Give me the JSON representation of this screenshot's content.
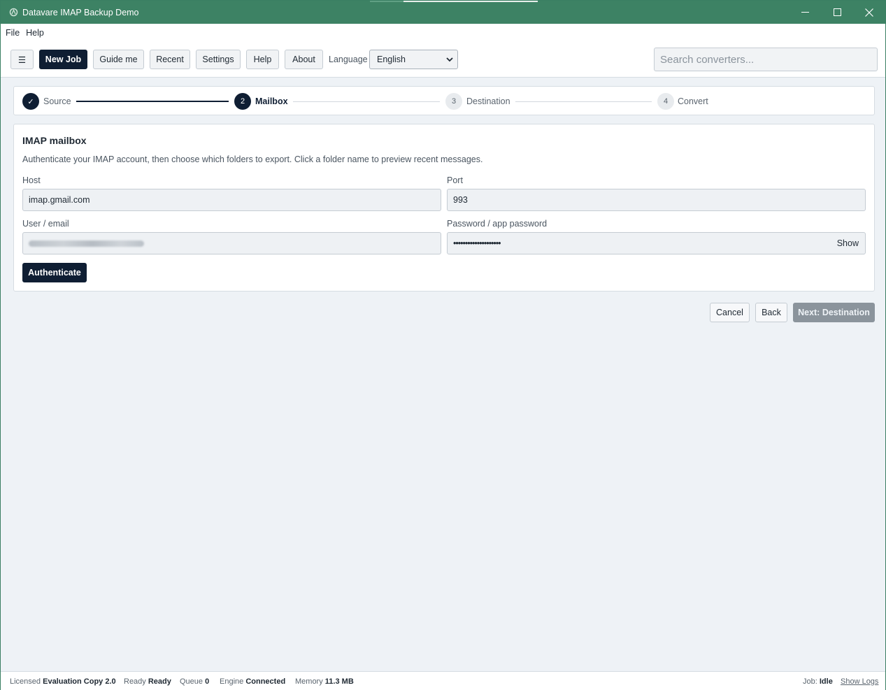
{
  "window": {
    "title": "Datavare IMAP Backup Demo",
    "controls": {
      "minimize": "—",
      "maximize": "☐",
      "close": "✕"
    }
  },
  "menu": [
    "File",
    "Help"
  ],
  "toolbar": {
    "hamburger": "☰",
    "new_job": "New Job",
    "guide_me": "Guide me",
    "recent": "Recent",
    "settings": "Settings",
    "help": "Help",
    "about": "About",
    "language_label": "Language",
    "language_value": "English",
    "search_placeholder": "Search converters..."
  },
  "stepper": {
    "steps": [
      {
        "number": "✓",
        "label": "Source",
        "state": "done"
      },
      {
        "number": "2",
        "label": "Mailbox",
        "state": "active"
      },
      {
        "number": "3",
        "label": "Destination",
        "state": "todo"
      },
      {
        "number": "4",
        "label": "Convert",
        "state": "todo"
      }
    ]
  },
  "card": {
    "title": "IMAP mailbox",
    "description": "Authenticate your IMAP account, then choose which folders to export. Click a folder name to preview recent messages.",
    "host_label": "Host",
    "host_value": "imap.gmail.com",
    "port_label": "Port",
    "port_value": "993",
    "user_label": "User / email",
    "password_label": "Password / app password",
    "password_value": "••••••••••••••••••••",
    "show_label": "Show",
    "authenticate": "Authenticate"
  },
  "nav": {
    "cancel": "Cancel",
    "back": "Back",
    "next": "Next: Destination"
  },
  "status": {
    "licensed_label": "Licensed",
    "licensed_value": "Evaluation Copy 2.0",
    "ready_label": "Ready",
    "ready_value": "Ready",
    "queue_label": "Queue",
    "queue_value": "0",
    "engine_label": "Engine",
    "engine_value": "Connected",
    "memory_label": "Memory",
    "memory_value": "11.3 MB",
    "job_label": "Job:",
    "job_value": "Idle",
    "show_logs": "Show Logs"
  },
  "colors": {
    "titlebar": "#3d8264",
    "primary": "#0f1e33",
    "background": "#eef2f6"
  }
}
